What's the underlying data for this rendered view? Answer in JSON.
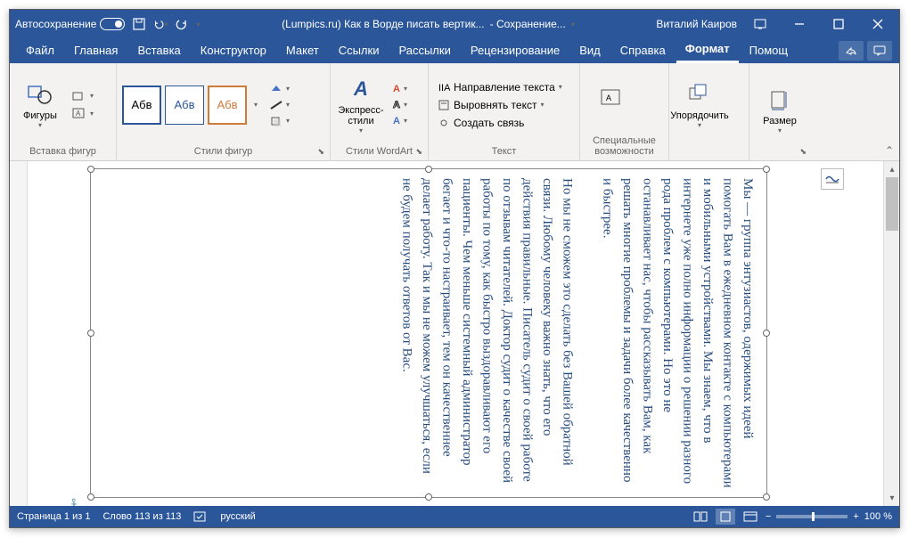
{
  "titlebar": {
    "autosave": "Автосохранение",
    "doc_title": "(Lumpics.ru) Как в Ворде писать вертик...",
    "saving": "- Сохранение...",
    "user": "Виталий Каиров"
  },
  "tabs": {
    "file": "Файл",
    "home": "Главная",
    "insert": "Вставка",
    "design": "Конструктор",
    "layout": "Макет",
    "references": "Ссылки",
    "mailings": "Рассылки",
    "review": "Рецензирование",
    "view": "Вид",
    "help": "Справка",
    "format": "Формат",
    "assist": "Помощ"
  },
  "ribbon": {
    "shapes": "Фигуры",
    "insert_shapes": "Вставка фигур",
    "abv": "Абв",
    "shape_styles": "Стили фигур",
    "express_styles": "Экспресс-стили",
    "wordart_styles": "Стили WordArt",
    "text_direction": "Направление текста",
    "align_text": "Выровнять текст",
    "create_link": "Создать связь",
    "text": "Текст",
    "special": "Специальные возможности",
    "arrange": "Упорядочить",
    "size": "Размер"
  },
  "document": {
    "text": "Мы — группа энтузиастов, одержимых идеей помогать Вам в ежедневном контакте с компьютерами и мобильными устройствами. Мы знаем, что в интернете уже полно информации о решении разного рода проблем с компьютерами. Но это не останавливает нас, чтобы рассказывать Вам, как решать многие проблемы и задачи более качественно и быстрее.\n\nНо мы не сможем это сделать без Вашей обратной связи. Любому человеку важно знать, что его действия правильные. Писатель судит о своей работе по отзывам читателей. Доктор судит о качестве своей работы по тому, как быстро выздоравливают его пациенты. Чем меньше системный администратор бегает и что-то настраивает, тем он качественнее делает работу. Так и мы не можем улучшаться, если не будем получать ответов от Вас."
  },
  "statusbar": {
    "page": "Страница 1 из 1",
    "words": "Слово 113 из 113",
    "lang": "русский",
    "zoom": "100 %"
  }
}
